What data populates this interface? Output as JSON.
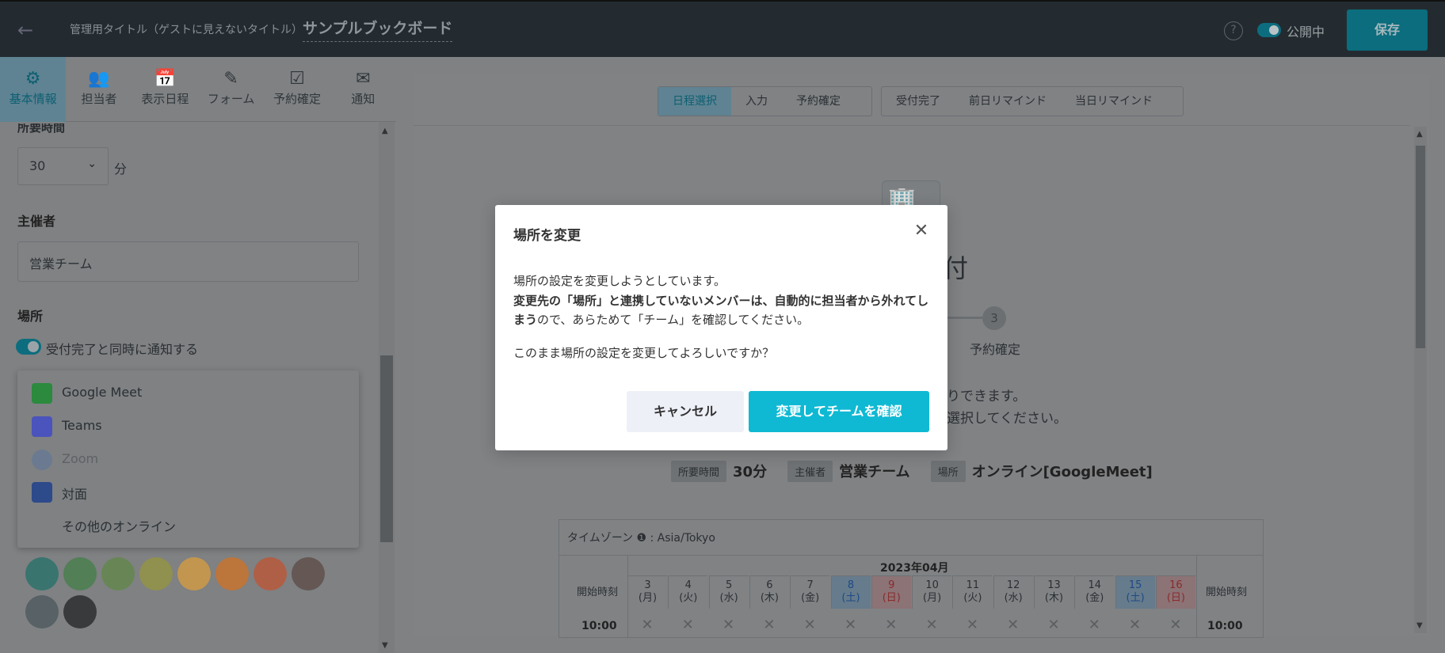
{
  "topbar": {
    "back_icon": "arrow-left-icon",
    "admin_title_label": "管理用タイトル（ゲストに見えないタイトル）",
    "board_title": "サンプルブックボード",
    "help_icon": "?",
    "public_label": "公開中",
    "save_label": "保存"
  },
  "left_tabs": [
    {
      "label": "基本情報",
      "icon": "sliders-icon",
      "glyph": "⚙"
    },
    {
      "label": "担当者",
      "icon": "people-icon",
      "glyph": "👥"
    },
    {
      "label": "表示日程",
      "icon": "calendar-icon",
      "glyph": "📅"
    },
    {
      "label": "フォーム",
      "icon": "form-edit-icon",
      "glyph": "✎"
    },
    {
      "label": "予約確定",
      "icon": "check-list-icon",
      "glyph": "☑"
    },
    {
      "label": "通知",
      "icon": "mail-icon",
      "glyph": "✉"
    }
  ],
  "form": {
    "duration_label": "所要時間",
    "duration_value": "30",
    "duration_unit": "分",
    "host_label": "主催者",
    "host_value": "営業チーム",
    "place_label": "場所",
    "notify_toggle_label": "受付完了と同時に通知する"
  },
  "place_options": [
    {
      "label": "Google Meet",
      "icon": "google-meet-icon",
      "color": "#2b8a3e"
    },
    {
      "label": "Teams",
      "icon": "teams-icon",
      "color": "#4b53bc"
    },
    {
      "label": "Zoom",
      "icon": "zoom-icon",
      "color": "#6b7a90"
    },
    {
      "label": "対面",
      "icon": "map-icon",
      "color": "#2d4a8a"
    },
    {
      "label": "その他のオンライン",
      "icon": "",
      "color": ""
    }
  ],
  "swatches": [
    "#00695c",
    "#2e7d32",
    "#558b2f",
    "#9e9d24",
    "#f9a825",
    "#ef6c00",
    "#d84315",
    "#4e342e",
    "#37474f",
    "#000000"
  ],
  "preview": {
    "step_tabs_a": [
      "日程選択",
      "入力",
      "予約確定"
    ],
    "step_tabs_b": [
      "受付完了",
      "前日リマインド",
      "当日リマインド"
    ],
    "big_char": "付",
    "step3_number": "3",
    "step3_label": "予約確定",
    "text1": "りできます。",
    "text2": "選択してください。",
    "info": [
      {
        "chip": "所要時間",
        "value": "30分"
      },
      {
        "chip": "主催者",
        "value": "営業チーム"
      },
      {
        "chip": "場所",
        "value": "オンライン[GoogleMeet]"
      }
    ],
    "calendar": {
      "timezone": "タイムゾーン ❶ : Asia/Tokyo",
      "month": "2023年04月",
      "start_time_label": "開始時刻",
      "days": [
        {
          "d": "3",
          "w": "(月)",
          "kind": ""
        },
        {
          "d": "4",
          "w": "(火)",
          "kind": ""
        },
        {
          "d": "5",
          "w": "(水)",
          "kind": ""
        },
        {
          "d": "6",
          "w": "(木)",
          "kind": ""
        },
        {
          "d": "7",
          "w": "(金)",
          "kind": ""
        },
        {
          "d": "8",
          "w": "(土)",
          "kind": "sat"
        },
        {
          "d": "9",
          "w": "(日)",
          "kind": "sun"
        },
        {
          "d": "10",
          "w": "(月)",
          "kind": ""
        },
        {
          "d": "11",
          "w": "(火)",
          "kind": ""
        },
        {
          "d": "12",
          "w": "(水)",
          "kind": ""
        },
        {
          "d": "13",
          "w": "(木)",
          "kind": ""
        },
        {
          "d": "14",
          "w": "(金)",
          "kind": ""
        },
        {
          "d": "15",
          "w": "(土)",
          "kind": "sat"
        },
        {
          "d": "16",
          "w": "(日)",
          "kind": "sun"
        }
      ],
      "first_time": "10:00",
      "unavailable_mark": "✕"
    }
  },
  "modal": {
    "title": "場所を変更",
    "line1": "場所の設定を変更しようとしています。",
    "bold_text": "変更先の「場所」と連携していないメンバーは、自動的に担当者から外れてしまう",
    "rest_text": "ので、あらためて「チーム」を確認してください。",
    "question": "このまま場所の設定を変更してよろしいですか？",
    "cancel_label": "キャンセル",
    "confirm_label": "変更してチームを確認"
  }
}
